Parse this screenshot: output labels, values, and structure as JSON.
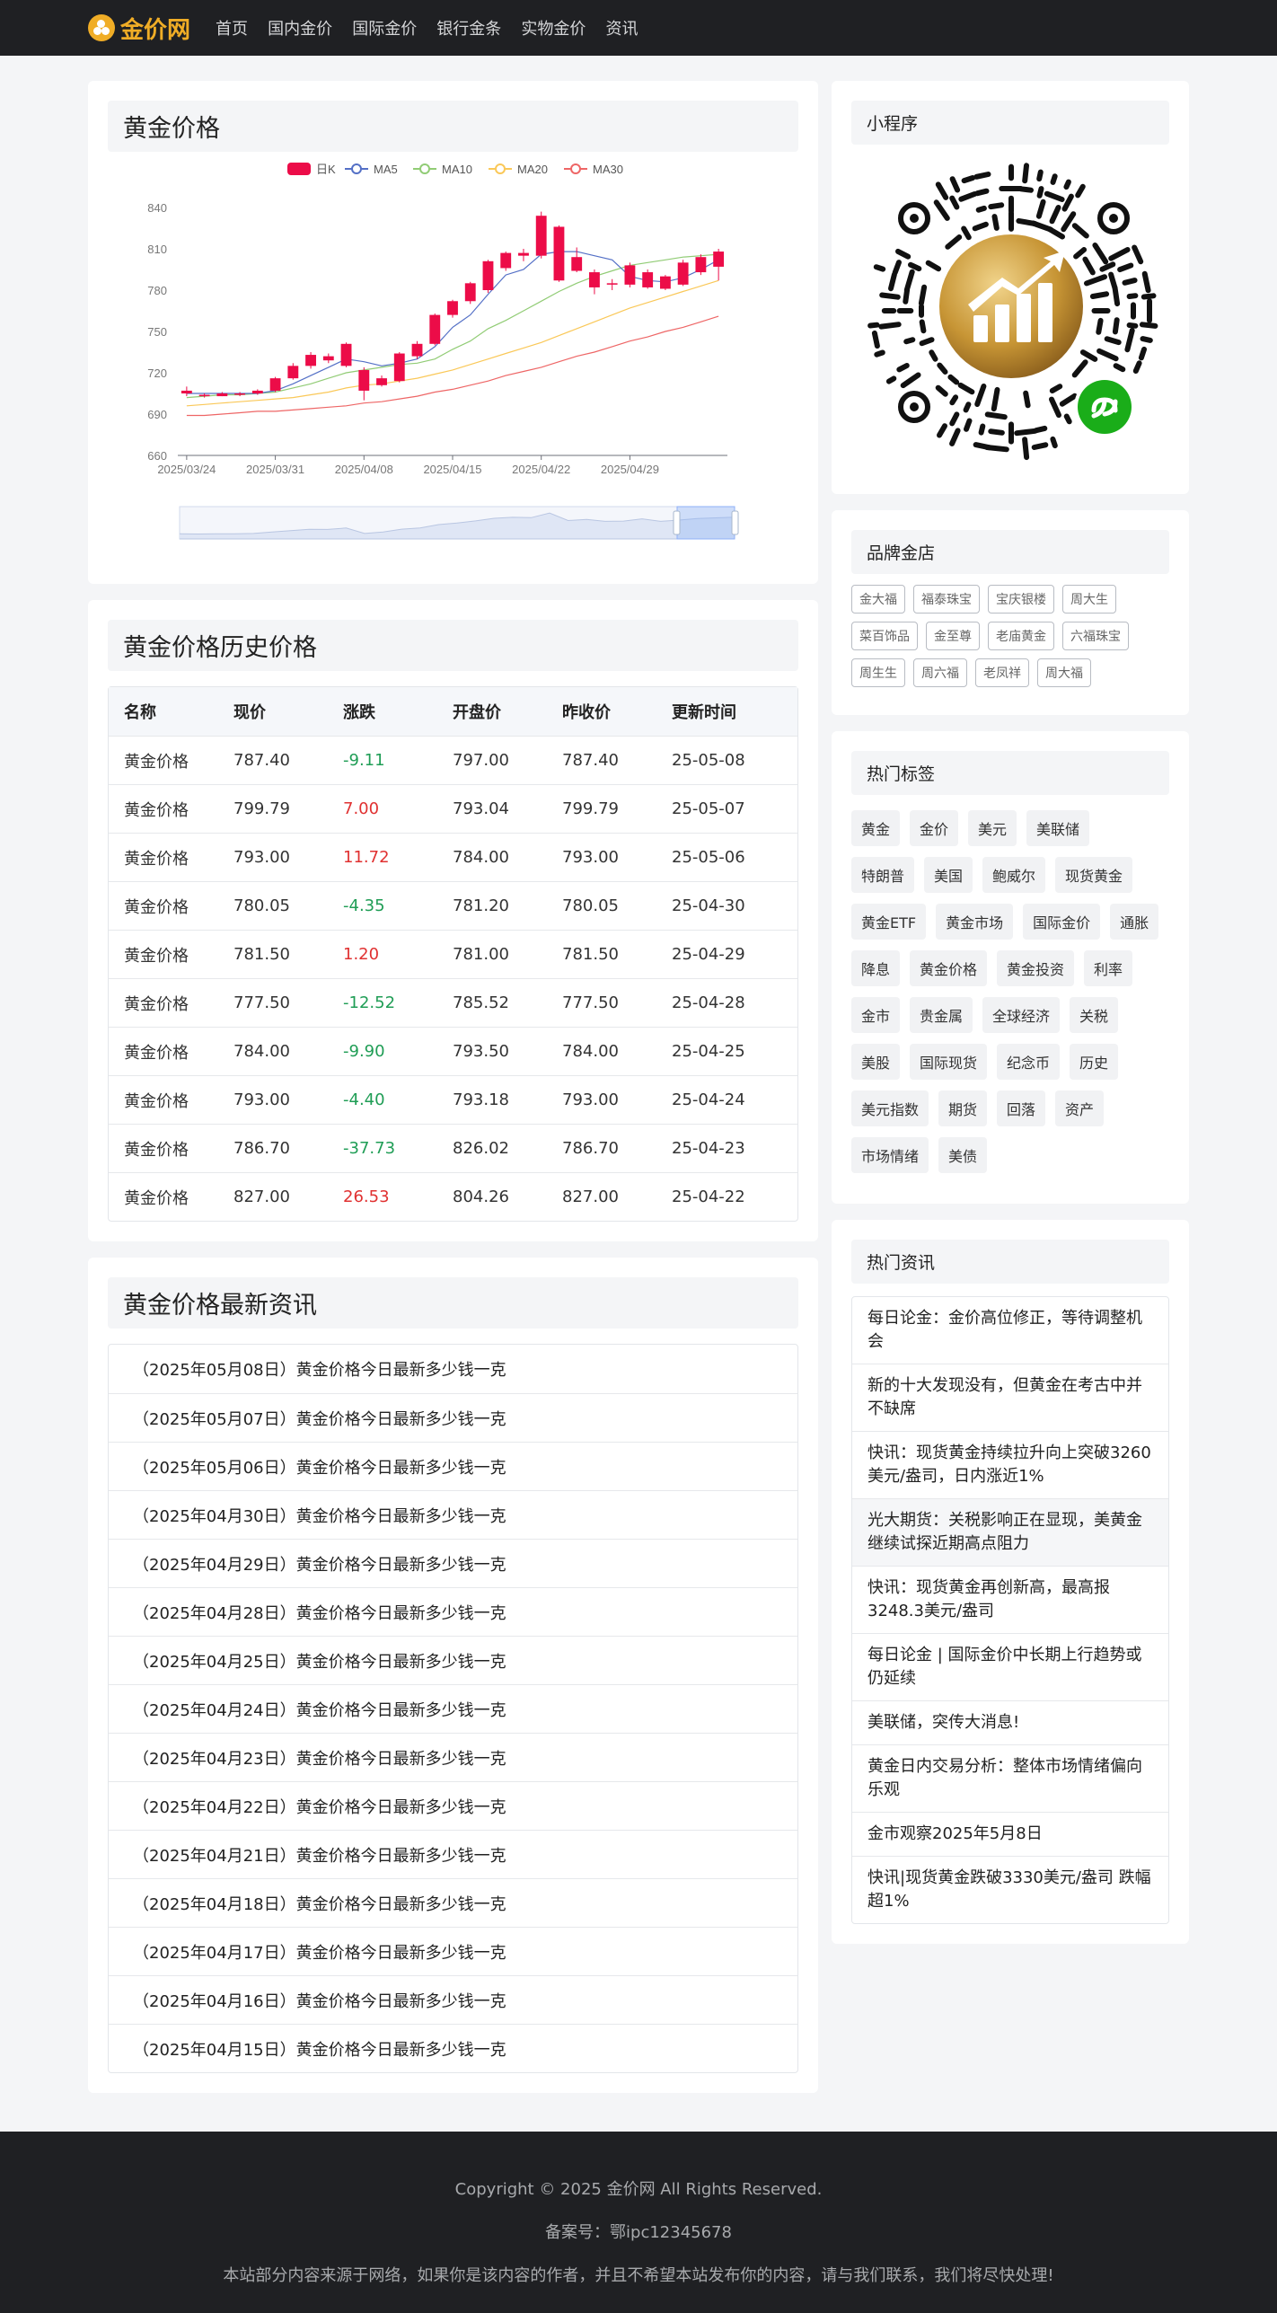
{
  "brand": {
    "name": "金价网",
    "accent": "#f0ad26"
  },
  "nav": [
    "首页",
    "国内金价",
    "国际金价",
    "银行金条",
    "实物金价",
    "资讯"
  ],
  "chart_card": {
    "title": "黄金价格"
  },
  "chart_data": {
    "type": "candlestick",
    "title": "",
    "legend": [
      "日K",
      "MA5",
      "MA10",
      "MA20",
      "MA30"
    ],
    "legend_colors": {
      "日K": "#ec0c48",
      "MA5": "#5470c6",
      "MA10": "#91cc75",
      "MA20": "#fac858",
      "MA30": "#ee6666"
    },
    "ylim": [
      660,
      840
    ],
    "yticks": [
      660,
      690,
      720,
      750,
      780,
      810,
      840
    ],
    "xticks": [
      "2025/03/24",
      "2025/03/31",
      "2025/04/08",
      "2025/04/15",
      "2025/04/22",
      "2025/04/29"
    ],
    "candles": [
      {
        "o": 707,
        "c": 705,
        "l": 703,
        "h": 710
      },
      {
        "o": 703,
        "c": 704,
        "l": 702,
        "h": 705
      },
      {
        "o": 703,
        "c": 705,
        "l": 703,
        "h": 706
      },
      {
        "o": 704,
        "c": 705,
        "l": 703,
        "h": 706
      },
      {
        "o": 705,
        "c": 707,
        "l": 704,
        "h": 708
      },
      {
        "o": 707,
        "c": 716,
        "l": 706,
        "h": 717
      },
      {
        "o": 716,
        "c": 725,
        "l": 715,
        "h": 727
      },
      {
        "o": 725,
        "c": 733,
        "l": 723,
        "h": 735
      },
      {
        "o": 729,
        "c": 732,
        "l": 727,
        "h": 734
      },
      {
        "o": 725,
        "c": 741,
        "l": 724,
        "h": 742
      },
      {
        "o": 722,
        "c": 707,
        "l": 700,
        "h": 724
      },
      {
        "o": 711,
        "c": 716,
        "l": 710,
        "h": 718
      },
      {
        "o": 714,
        "c": 734,
        "l": 713,
        "h": 735
      },
      {
        "o": 732,
        "c": 741,
        "l": 730,
        "h": 743
      },
      {
        "o": 741,
        "c": 762,
        "l": 740,
        "h": 763
      },
      {
        "o": 762,
        "c": 772,
        "l": 760,
        "h": 773
      },
      {
        "o": 772,
        "c": 785,
        "l": 770,
        "h": 786
      },
      {
        "o": 780,
        "c": 801,
        "l": 778,
        "h": 802
      },
      {
        "o": 796,
        "c": 807,
        "l": 794,
        "h": 808
      },
      {
        "o": 807,
        "c": 805,
        "l": 801,
        "h": 810
      },
      {
        "o": 805,
        "c": 834,
        "l": 803,
        "h": 837
      },
      {
        "o": 826,
        "c": 787,
        "l": 786,
        "h": 827
      },
      {
        "o": 804,
        "c": 794,
        "l": 793,
        "h": 811
      },
      {
        "o": 793,
        "c": 782,
        "l": 777,
        "h": 795
      },
      {
        "o": 785,
        "c": 784,
        "l": 780,
        "h": 788
      },
      {
        "o": 784,
        "c": 798,
        "l": 782,
        "h": 800
      },
      {
        "o": 793,
        "c": 782,
        "l": 781,
        "h": 795
      },
      {
        "o": 781,
        "c": 790,
        "l": 780,
        "h": 791
      },
      {
        "o": 784,
        "c": 800,
        "l": 783,
        "h": 802
      },
      {
        "o": 793,
        "c": 804,
        "l": 791,
        "h": 806
      },
      {
        "o": 797,
        "c": 808,
        "l": 787,
        "h": 810
      }
    ],
    "ma5": [
      705,
      705,
      705,
      705,
      705,
      707,
      712,
      718,
      724,
      730,
      728,
      725,
      727,
      730,
      739,
      753,
      762,
      777,
      791,
      795,
      806,
      808,
      808,
      805,
      802,
      790,
      787,
      786,
      789,
      795,
      802
    ],
    "ma10": [
      702,
      703,
      704,
      704,
      705,
      706,
      709,
      712,
      716,
      720,
      722,
      724,
      726,
      727,
      730,
      737,
      743,
      752,
      758,
      765,
      772,
      779,
      785,
      790,
      794,
      798,
      800,
      802,
      804,
      805,
      806
    ],
    "ma20": [
      696,
      697,
      698,
      699,
      700,
      701,
      702,
      704,
      706,
      709,
      711,
      712,
      714,
      716,
      719,
      722,
      726,
      730,
      734,
      738,
      742,
      747,
      752,
      757,
      762,
      767,
      771,
      775,
      779,
      783,
      787
    ],
    "ma30": [
      689,
      689,
      690,
      691,
      692,
      692,
      693,
      694,
      695,
      696,
      698,
      699,
      701,
      703,
      706,
      708,
      711,
      714,
      718,
      721,
      724,
      728,
      732,
      735,
      739,
      743,
      746,
      750,
      753,
      757,
      761
    ]
  },
  "history": {
    "title": "黄金价格历史价格",
    "columns": [
      "名称",
      "现价",
      "涨跌",
      "开盘价",
      "昨收价",
      "更新时间"
    ],
    "rows": [
      {
        "name": "黄金价格",
        "price": "787.40",
        "change": "-9.11",
        "dir": "down",
        "open": "797.00",
        "prev": "787.40",
        "date": "25-05-08"
      },
      {
        "name": "黄金价格",
        "price": "799.79",
        "change": "7.00",
        "dir": "up",
        "open": "793.04",
        "prev": "799.79",
        "date": "25-05-07"
      },
      {
        "name": "黄金价格",
        "price": "793.00",
        "change": "11.72",
        "dir": "up",
        "open": "784.00",
        "prev": "793.00",
        "date": "25-05-06"
      },
      {
        "name": "黄金价格",
        "price": "780.05",
        "change": "-4.35",
        "dir": "down",
        "open": "781.20",
        "prev": "780.05",
        "date": "25-04-30"
      },
      {
        "name": "黄金价格",
        "price": "781.50",
        "change": "1.20",
        "dir": "up",
        "open": "781.00",
        "prev": "781.50",
        "date": "25-04-29"
      },
      {
        "name": "黄金价格",
        "price": "777.50",
        "change": "-12.52",
        "dir": "down",
        "open": "785.52",
        "prev": "777.50",
        "date": "25-04-28"
      },
      {
        "name": "黄金价格",
        "price": "784.00",
        "change": "-9.90",
        "dir": "down",
        "open": "793.50",
        "prev": "784.00",
        "date": "25-04-25"
      },
      {
        "name": "黄金价格",
        "price": "793.00",
        "change": "-4.40",
        "dir": "down",
        "open": "793.18",
        "prev": "793.00",
        "date": "25-04-24"
      },
      {
        "name": "黄金价格",
        "price": "786.70",
        "change": "-37.73",
        "dir": "down",
        "open": "826.02",
        "prev": "786.70",
        "date": "25-04-23"
      },
      {
        "name": "黄金价格",
        "price": "827.00",
        "change": "26.53",
        "dir": "up",
        "open": "804.26",
        "prev": "827.00",
        "date": "25-04-22"
      }
    ]
  },
  "news": {
    "title": "黄金价格最新资讯",
    "items": [
      "（2025年05月08日）黄金价格今日最新多少钱一克",
      "（2025年05月07日）黄金价格今日最新多少钱一克",
      "（2025年05月06日）黄金价格今日最新多少钱一克",
      "（2025年04月30日）黄金价格今日最新多少钱一克",
      "（2025年04月29日）黄金价格今日最新多少钱一克",
      "（2025年04月28日）黄金价格今日最新多少钱一克",
      "（2025年04月25日）黄金价格今日最新多少钱一克",
      "（2025年04月24日）黄金价格今日最新多少钱一克",
      "（2025年04月23日）黄金价格今日最新多少钱一克",
      "（2025年04月22日）黄金价格今日最新多少钱一克",
      "（2025年04月21日）黄金价格今日最新多少钱一克",
      "（2025年04月18日）黄金价格今日最新多少钱一克",
      "（2025年04月17日）黄金价格今日最新多少钱一克",
      "（2025年04月16日）黄金价格今日最新多少钱一克",
      "（2025年04月15日）黄金价格今日最新多少钱一克"
    ]
  },
  "sidebar": {
    "miniapp": {
      "title": "小程序"
    },
    "brands": {
      "title": "品牌金店",
      "items": [
        "金大福",
        "福泰珠宝",
        "宝庆银楼",
        "周大生",
        "菜百饰品",
        "金至尊",
        "老庙黄金",
        "六福珠宝",
        "周生生",
        "周六福",
        "老凤祥",
        "周大福"
      ]
    },
    "tags": {
      "title": "热门标签",
      "items": [
        "黄金",
        "金价",
        "美元",
        "美联储",
        "特朗普",
        "美国",
        "鲍威尔",
        "现货黄金",
        "黄金ETF",
        "黄金市场",
        "国际金价",
        "通胀",
        "降息",
        "黄金价格",
        "黄金投资",
        "利率",
        "金市",
        "贵金属",
        "全球经济",
        "关税",
        "美股",
        "国际现货",
        "纪念币",
        "历史",
        "美元指数",
        "期货",
        "回落",
        "资产",
        "市场情绪",
        "美债"
      ]
    },
    "hot": {
      "title": "热门资讯",
      "items": [
        "每日论金：金价高位修正，等待调整机会",
        "新的十大发现没有，但黄金在考古中并不缺席",
        "快讯：现货黄金持续拉升向上突破3260美元/盎司，日内涨近1%",
        "光大期货：关税影响正在显现，美黄金继续试探近期高点阻力",
        "快讯：现货黄金再创新高，最高报3248.3美元/盎司",
        "每日论金 | 国际金价中长期上行趋势或仍延续",
        "美联储，突传大消息!",
        "黄金日内交易分析：整体市场情绪偏向乐观",
        "金市观察2025年5月8日",
        "快讯|现货黄金跌破3330美元/盎司 跌幅超1%"
      ]
    }
  },
  "footer": {
    "copyright": "Copyright © 2025 金价网 All Rights Reserved.",
    "icp": "备案号：鄂ipc12345678",
    "notice": "本站部分内容来源于网络，如果你是该内容的作者，并且不希望本站发布你的内容，请与我们联系，我们将尽快处理!"
  }
}
